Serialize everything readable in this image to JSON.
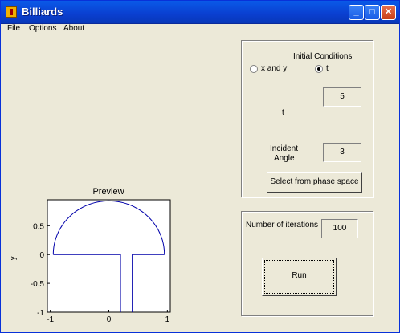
{
  "window": {
    "title": "Billiards"
  },
  "menubar": {
    "items": [
      "File",
      "Options",
      "About"
    ]
  },
  "initial_conditions": {
    "title": "Initial Conditions",
    "radio_xy": "x and y",
    "radio_t": "t",
    "selected": "t",
    "t_label": "t",
    "t_value": "5",
    "angle_label_1": "Incident",
    "angle_label_2": "Angle",
    "angle_value": "3",
    "select_button": "Select from phase space"
  },
  "iterations": {
    "label": "Number of iterations",
    "value": "100",
    "run_button": "Run"
  },
  "preview": {
    "title": "Preview",
    "ylabel": "y",
    "x_ticks": [
      "-1",
      "0",
      "1"
    ],
    "y_ticks": [
      "0.5",
      "0",
      "-0.5",
      "-1"
    ]
  },
  "chart_data": {
    "type": "line",
    "title": "Preview",
    "ylabel": "y",
    "xlim": [
      -1.05,
      1.05
    ],
    "ylim": [
      -1,
      0.95
    ],
    "series": [
      {
        "x": [
          -0.95,
          -0.95,
          -0.8,
          -0.6,
          -0.4,
          -0.2,
          0,
          0.2,
          0.4,
          0.6,
          0.8,
          0.95,
          0.95,
          0.4,
          0.4,
          0.35,
          0.35,
          0.2,
          0.2,
          0.15,
          0.15,
          -0.95
        ],
        "y": [
          0,
          0.05,
          0.58,
          0.76,
          0.86,
          0.92,
          0.93,
          0.92,
          0.86,
          0.76,
          0.58,
          0.05,
          0,
          0,
          -0.0,
          0,
          -1,
          -1,
          0,
          0,
          0,
          0
        ]
      }
    ]
  },
  "colors": {
    "curve": "#0000aa",
    "title_gradient": "#0a5ae8"
  }
}
